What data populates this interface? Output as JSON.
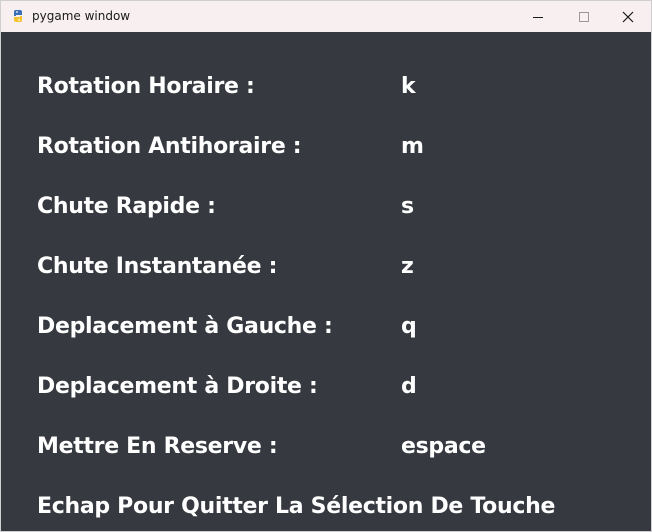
{
  "window": {
    "title": "pygame window",
    "icon": "pygame-snake-icon"
  },
  "bindings": [
    {
      "label": "Rotation Horaire :",
      "key": "k"
    },
    {
      "label": "Rotation Antihoraire :",
      "key": "m"
    },
    {
      "label": "Chute Rapide :",
      "key": "s"
    },
    {
      "label": "Chute Instantanée :",
      "key": "z"
    },
    {
      "label": "Deplacement à Gauche :",
      "key": "q"
    },
    {
      "label": "Deplacement à Droite :",
      "key": "d"
    },
    {
      "label": "Mettre En Reserve :",
      "key": "espace"
    }
  ],
  "footer": "Echap Pour Quitter La Sélection De Touche",
  "colors": {
    "background": "#36393f",
    "text": "#ffffff",
    "titlebar": "#f7eff0"
  }
}
